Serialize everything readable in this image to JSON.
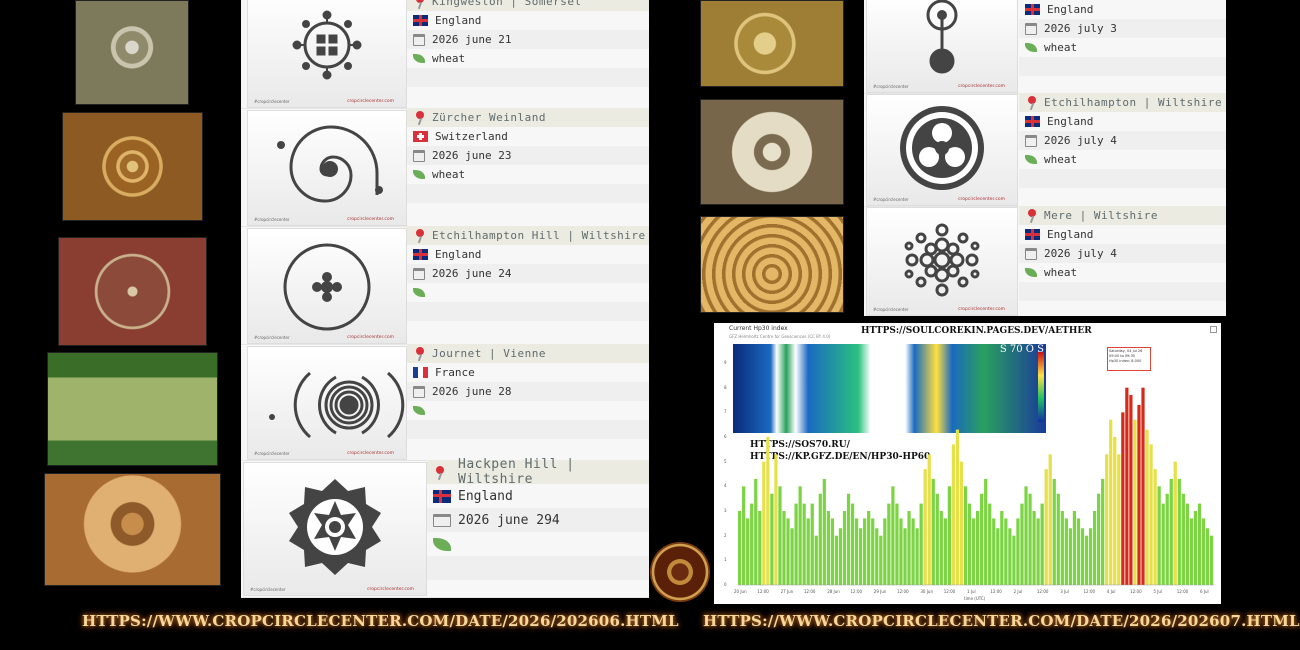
{
  "left_panel": {
    "entries": [
      {
        "title": "Kingweston | Somerset",
        "country": "England",
        "flag": "uk",
        "date": "2026 june 21",
        "crop": "wheat",
        "thumb_icon": "flower-dots-formation-icon"
      },
      {
        "title": "Zürcher Weinland",
        "country": "Switzerland",
        "flag": "ch",
        "date": "2026 june 23",
        "crop": "wheat",
        "thumb_icon": "spiral-formation-icon"
      },
      {
        "title": "Etchilhampton Hill | Wiltshire",
        "country": "England",
        "flag": "uk",
        "date": "2026 june 24",
        "crop": "",
        "thumb_icon": "ring-cross-formation-icon"
      },
      {
        "title": "Journet | Vienne",
        "country": "France",
        "flag": "fr",
        "date": "2026 june 28",
        "crop": "",
        "thumb_icon": "concentric-arcs-formation-icon"
      },
      {
        "title": "Hackpen Hill | Wiltshire",
        "country": "England",
        "flag": "uk",
        "date": "2026 june 294",
        "crop": "",
        "thumb_icon": "mandala-formation-icon"
      }
    ]
  },
  "right_panel": {
    "entries": [
      {
        "title": "",
        "country": "England",
        "flag": "uk",
        "date": "2026 july 3",
        "crop": "wheat",
        "thumb_icon": "key-formation-icon"
      },
      {
        "title": "Etchilhampton | Wiltshire",
        "country": "England",
        "flag": "uk",
        "date": "2026 july 4",
        "crop": "wheat",
        "thumb_icon": "celtic-knot-formation-icon"
      },
      {
        "title": "Mere | Wiltshire",
        "country": "England",
        "flag": "uk",
        "date": "2026 july 4",
        "crop": "wheat",
        "thumb_icon": "circles-cluster-formation-icon"
      }
    ]
  },
  "thumb_brand": "#cropcirclecenter",
  "thumb_site": "cropcirclecenter.com",
  "chart": {
    "title": "Current Hp30 index",
    "subtitle": "GFZ Helmholtz Centre for Geosciences (CC BY 4.0)",
    "url_top": "HTTPS://SOULCOREKIN.PAGES.DEV/AETHER",
    "url_mid1": "HTTPS://SOS70.RU/",
    "url_mid2": "HTTPS://KP.GFZ.DE/EN/HP30-HP60",
    "sos_label": "S 70 O S",
    "tooltip": [
      "Saturday, 04 Jul 26",
      "09:00 to 09:30",
      "Hp30 index: 8.000"
    ],
    "x_axis_title": "time (UTC)",
    "x_ticks": [
      "20 Jun",
      "12:00",
      "27 Jun",
      "12:00",
      "28 Jun",
      "12:00",
      "29 Jun",
      "12:00",
      "30 Jun",
      "12:00",
      "1 Jul",
      "12:00",
      "2 Jul",
      "12:00",
      "3 Jul",
      "12:00",
      "4 Jul",
      "12:00",
      "5 Jul",
      "12:00",
      "6 Jul"
    ],
    "y_ticks": [
      "0",
      "1",
      "2",
      "3",
      "4",
      "5",
      "6",
      "7",
      "8",
      "9"
    ],
    "colors": {
      "low": "#7cd444",
      "mid": "#e6e04a",
      "high": "#d42a1a"
    }
  },
  "chart_data": {
    "type": "bar",
    "title": "Current Hp30 index",
    "xlabel": "time (UTC)",
    "ylabel": "",
    "ylim": [
      0,
      9
    ],
    "values": [
      3,
      4,
      2.7,
      3.3,
      4.3,
      3,
      5,
      6,
      3.7,
      5.3,
      4,
      3,
      2.7,
      2.3,
      3.3,
      4,
      3.3,
      2.7,
      3.3,
      2,
      3.7,
      4.3,
      3,
      2.7,
      2,
      2.3,
      3,
      3.7,
      3.3,
      2.7,
      2.3,
      2.7,
      3,
      2.7,
      2.3,
      2,
      2.7,
      3.3,
      4,
      3.3,
      2.7,
      2.3,
      3,
      2.7,
      2.3,
      3.3,
      4.7,
      5.3,
      4.3,
      3.7,
      3,
      2.7,
      4,
      5.7,
      6.3,
      5,
      4,
      3.3,
      2.7,
      3,
      3.7,
      4.3,
      3.3,
      2.7,
      2.3,
      3,
      2.7,
      2.3,
      2,
      2.7,
      3.3,
      4,
      3.7,
      3,
      2.7,
      3.3,
      4.7,
      5.3,
      4.3,
      3.7,
      3,
      2.7,
      2.3,
      3,
      2.7,
      2.3,
      2,
      2.3,
      3,
      3.7,
      4.3,
      5.3,
      6.7,
      6,
      5.3,
      7,
      8,
      7.7,
      6.7,
      7.3,
      8,
      6.3,
      5.7,
      4.7,
      4,
      3.3,
      3.7,
      4.3,
      5,
      4.3,
      3.7,
      3.3,
      2.7,
      3,
      3.3,
      2.7,
      2.3,
      2
    ]
  },
  "bottom_links": {
    "left": "HTTPS://WWW.CROPCIRCLECENTER.COM/DATE/2026/202606.HTML",
    "right": "HTTPS://WWW.CROPCIRCLECENTER.COM/DATE/2026/202607.HTML"
  }
}
